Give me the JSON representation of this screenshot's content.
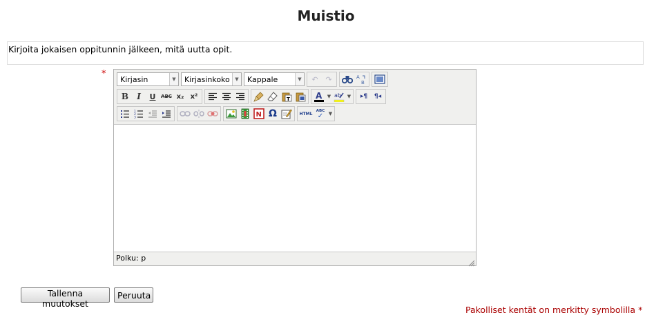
{
  "page": {
    "title": "Muistio"
  },
  "instructions": "Kirjoita jokaisen oppitunnin jälkeen, mitä uutta opit.",
  "required_marker": "*",
  "editor": {
    "toolbar": {
      "font_select": "Kirjasin",
      "size_select": "Kirjasinkoko",
      "format_select": "Kappale",
      "bold": "B",
      "italic": "I",
      "underline": "U",
      "strikethrough": "ABC",
      "subscript": "x₂",
      "superscript": "x²",
      "omega": "Ω",
      "html_label": "HTML",
      "spell_label": "ABC"
    },
    "content": "",
    "path_label": "Polku: p"
  },
  "buttons": {
    "save": "Tallenna muutokset",
    "cancel": "Peruuta"
  },
  "required_note": "Pakolliset kentät on merkitty symbolilla",
  "colors": {
    "required": "#cc0000",
    "toolbar_bg": "#f0f0ee"
  }
}
